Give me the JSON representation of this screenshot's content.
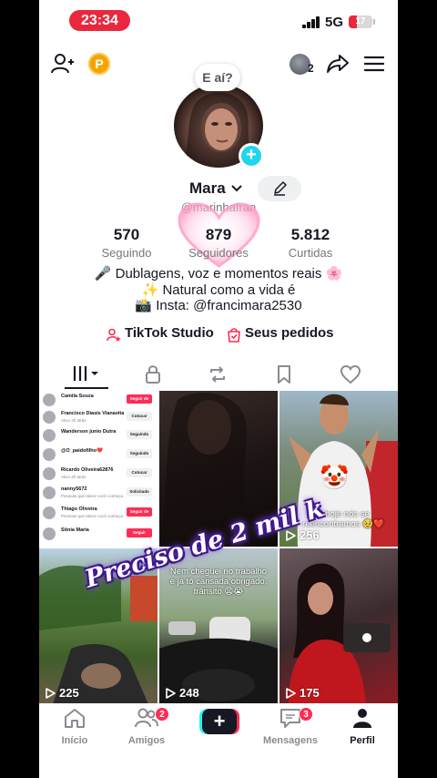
{
  "status_bar": {
    "time": "23:34",
    "network": "5G",
    "battery": "17"
  },
  "header": {
    "coin_label": "P",
    "notification_count": "2"
  },
  "profile": {
    "story_bubble": "E aí?",
    "name": "Mara",
    "handle": "@marinhafran",
    "stats": [
      {
        "value": "570",
        "label": "Seguindo"
      },
      {
        "value": "879",
        "label": "Seguidores"
      },
      {
        "value": "5.812",
        "label": "Curtidas"
      }
    ],
    "bio": [
      "🎤 Dublagens, voz e momentos reais 🌸",
      "✨ Natural como a vida é",
      "📸 Insta: @francimara2530"
    ],
    "links": {
      "studio": "TikTok Studio",
      "orders": "Seus pedidos"
    }
  },
  "tabs": [
    "videos-tab",
    "private-tab",
    "reposts-tab",
    "favorites-tab",
    "liked-tab"
  ],
  "videos": [
    {
      "views": "",
      "caption": ""
    },
    {
      "views": "",
      "caption": ""
    },
    {
      "views": "256",
      "caption": "E hoje nós se reencontramos 🥹❤️"
    },
    {
      "views": "225",
      "caption": ""
    },
    {
      "views": "248",
      "caption": "Nem cheguei no trabalho e já tô cansada obrigado, trânsito 😩😭"
    },
    {
      "views": "175",
      "caption": ""
    }
  ],
  "follower_list": [
    {
      "name": "Camila Souza",
      "sub": "",
      "button": "Seguir de volta",
      "style": "red"
    },
    {
      "name": "Francisco Diasis Vianavita",
      "sub": "Ativo 2h atrás",
      "button": "Cutucar",
      "style": "grey"
    },
    {
      "name": "Wanderson junio Dutra",
      "sub": "",
      "button": "Seguindo",
      "style": "grey"
    },
    {
      "name": "@O_paidofilho❤️",
      "sub": "",
      "button": "Seguindo",
      "style": "grey"
    },
    {
      "name": "Ricardo Oliveira62876",
      "sub": "Ativo 2h atrás",
      "button": "Cutucar",
      "style": "grey"
    },
    {
      "name": "nanny5672",
      "sub": "Pessoas que talvez você conheça",
      "button": "Solicitado",
      "style": "grey"
    },
    {
      "name": "Thiago Oliveira",
      "sub": "Pessoas que talvez você conheça",
      "button": "Seguir de volta",
      "style": "red"
    },
    {
      "name": "Sônia Maria",
      "sub": "",
      "button": "Seguir",
      "style": "red"
    }
  ],
  "overlay_text": "Preciso de 2 mil k",
  "bottom_nav": [
    {
      "label": "Início",
      "badge": ""
    },
    {
      "label": "Amigos",
      "badge": "2"
    },
    {
      "label": "",
      "badge": ""
    },
    {
      "label": "Mensagens",
      "badge": "3"
    },
    {
      "label": "Perfil",
      "badge": ""
    }
  ],
  "colors": {
    "accent": "#fe2c55",
    "cyan": "#25f4ee",
    "time_pill": "#e9273d",
    "add_badge": "#20d5ec"
  }
}
